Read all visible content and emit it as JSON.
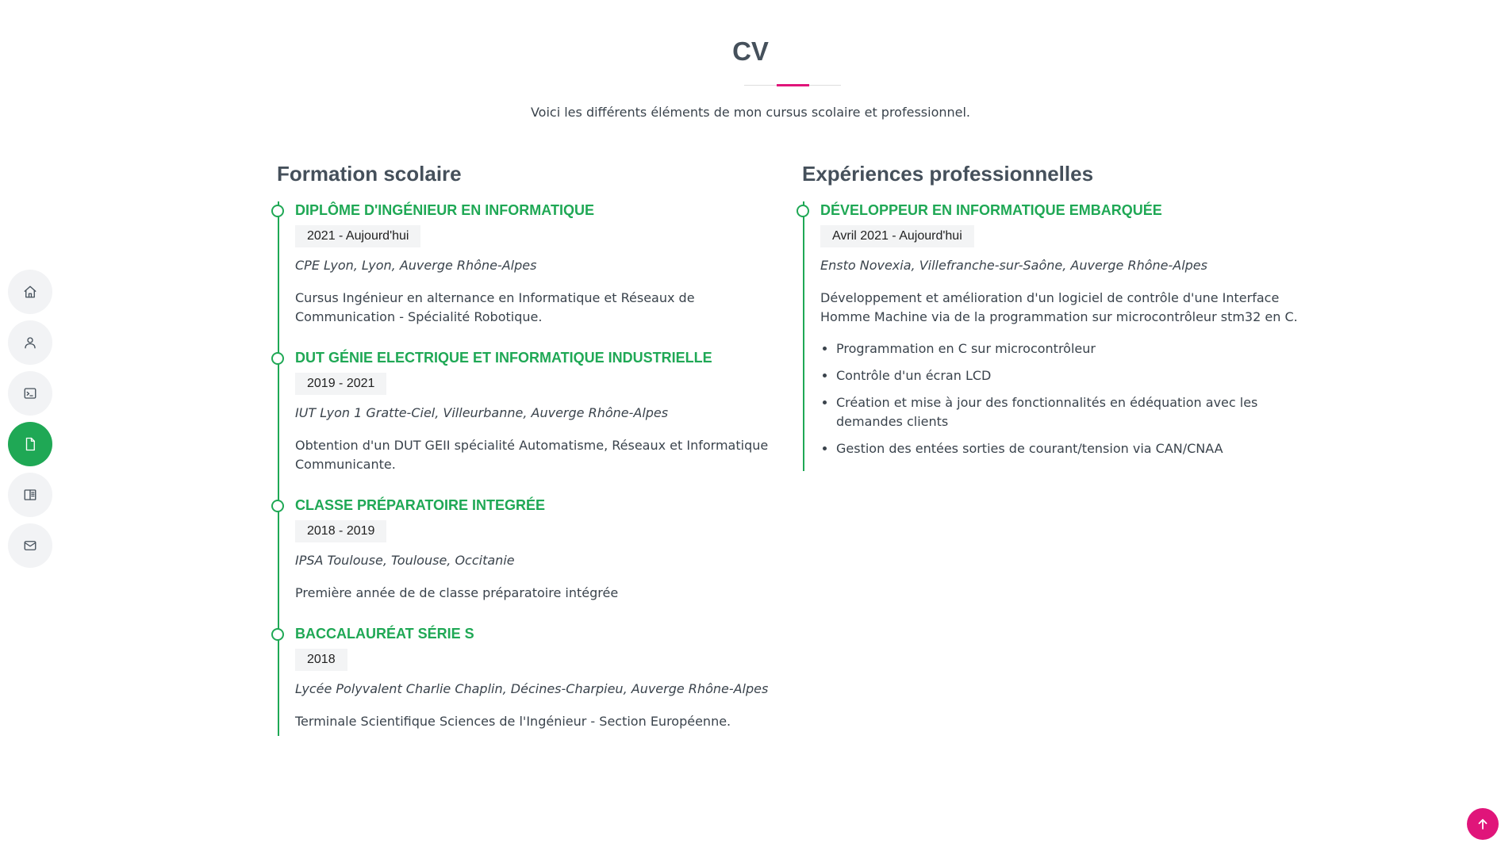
{
  "nav": {
    "items": [
      {
        "name": "home",
        "icon": "house-icon"
      },
      {
        "name": "about",
        "icon": "person-icon"
      },
      {
        "name": "terminal",
        "icon": "terminal-icon"
      },
      {
        "name": "cv",
        "icon": "file-icon",
        "active": true
      },
      {
        "name": "portfolio",
        "icon": "book-icon"
      },
      {
        "name": "contact",
        "icon": "envelope-icon"
      }
    ]
  },
  "header": {
    "title": "CV",
    "subtitle": "Voici les différents éléments de mon cursus scolaire et professionnel."
  },
  "education": {
    "heading": "Formation scolaire",
    "entries": [
      {
        "title": "DIPLÔME D'INGÉNIEUR EN INFORMATIQUE",
        "date": "2021 - Aujourd'hui",
        "place": "CPE Lyon, Lyon, Auverge Rhône-Alpes",
        "description": "Cursus Ingénieur en alternance en Informatique et Réseaux de Communication - Spécialité Robotique."
      },
      {
        "title": "DUT GÉNIE ELECTRIQUE ET INFORMATIQUE INDUSTRIELLE",
        "date": "2019 - 2021",
        "place": "IUT Lyon 1 Gratte-Ciel, Villeurbanne, Auverge Rhône-Alpes",
        "description": "Obtention d'un DUT GEII spécialité Automatisme, Réseaux et Informatique Communicante."
      },
      {
        "title": "CLASSE PRÉPARATOIRE INTEGRÉE",
        "date": "2018 - 2019",
        "place": "IPSA Toulouse, Toulouse, Occitanie",
        "description": "Première année de de classe préparatoire intégrée"
      },
      {
        "title": "BACCALAURÉAT SÉRIE S",
        "date": "2018",
        "place": "Lycée Polyvalent Charlie Chaplin, Décines-Charpieu, Auverge Rhône-Alpes",
        "description": "Terminale Scientifique Sciences de l'Ingénieur - Section Européenne."
      }
    ]
  },
  "experience": {
    "heading": "Expériences professionnelles",
    "entries": [
      {
        "title": "DÉVELOPPEUR EN INFORMATIQUE EMBARQUÉE",
        "date": "Avril 2021 - Aujourd'hui",
        "place": "Ensto Novexia, Villefranche-sur-Saône, Auverge Rhône-Alpes",
        "description": "Développement et amélioration d'un logiciel de contrôle d'une Interface Homme Machine via de la programmation sur microcontrôleur stm32 en C.",
        "bullets": [
          "Programmation en C sur microcontrôleur",
          "Contrôle d'un écran LCD",
          "Création et mise à jour des fonctionnalités en édéquation avec les demandes clients",
          "Gestion des entées sorties de courant/tension via CAN/CNAA"
        ]
      }
    ]
  },
  "colors": {
    "accent_green": "#1fa855",
    "accent_pink": "#e0157a",
    "heading": "#45505b"
  },
  "back_to_top": {
    "icon": "arrow-up-icon"
  }
}
